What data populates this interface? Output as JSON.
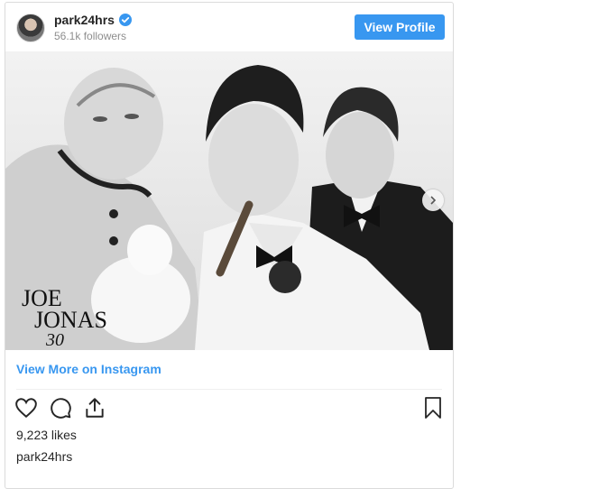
{
  "post": {
    "username": "park24hrs",
    "followers": "56.1k followers",
    "view_profile_label": "View Profile",
    "view_more_label": "View More on Instagram",
    "likes": "9,223 likes",
    "caption_username": "park24hrs"
  },
  "photo": {
    "description_icon": "photo-booth-image",
    "logo_text_line1": "JOE",
    "logo_text_line2": "JONAS",
    "logo_text_line3": "30"
  },
  "colors": {
    "accent": "#3897f0",
    "text": "#262626",
    "muted": "#8e8e8e",
    "border": "#dbdbdb"
  },
  "icons": [
    "verified-badge-icon",
    "heart-icon",
    "comment-icon",
    "share-icon",
    "bookmark-icon",
    "chevron-right-icon"
  ]
}
